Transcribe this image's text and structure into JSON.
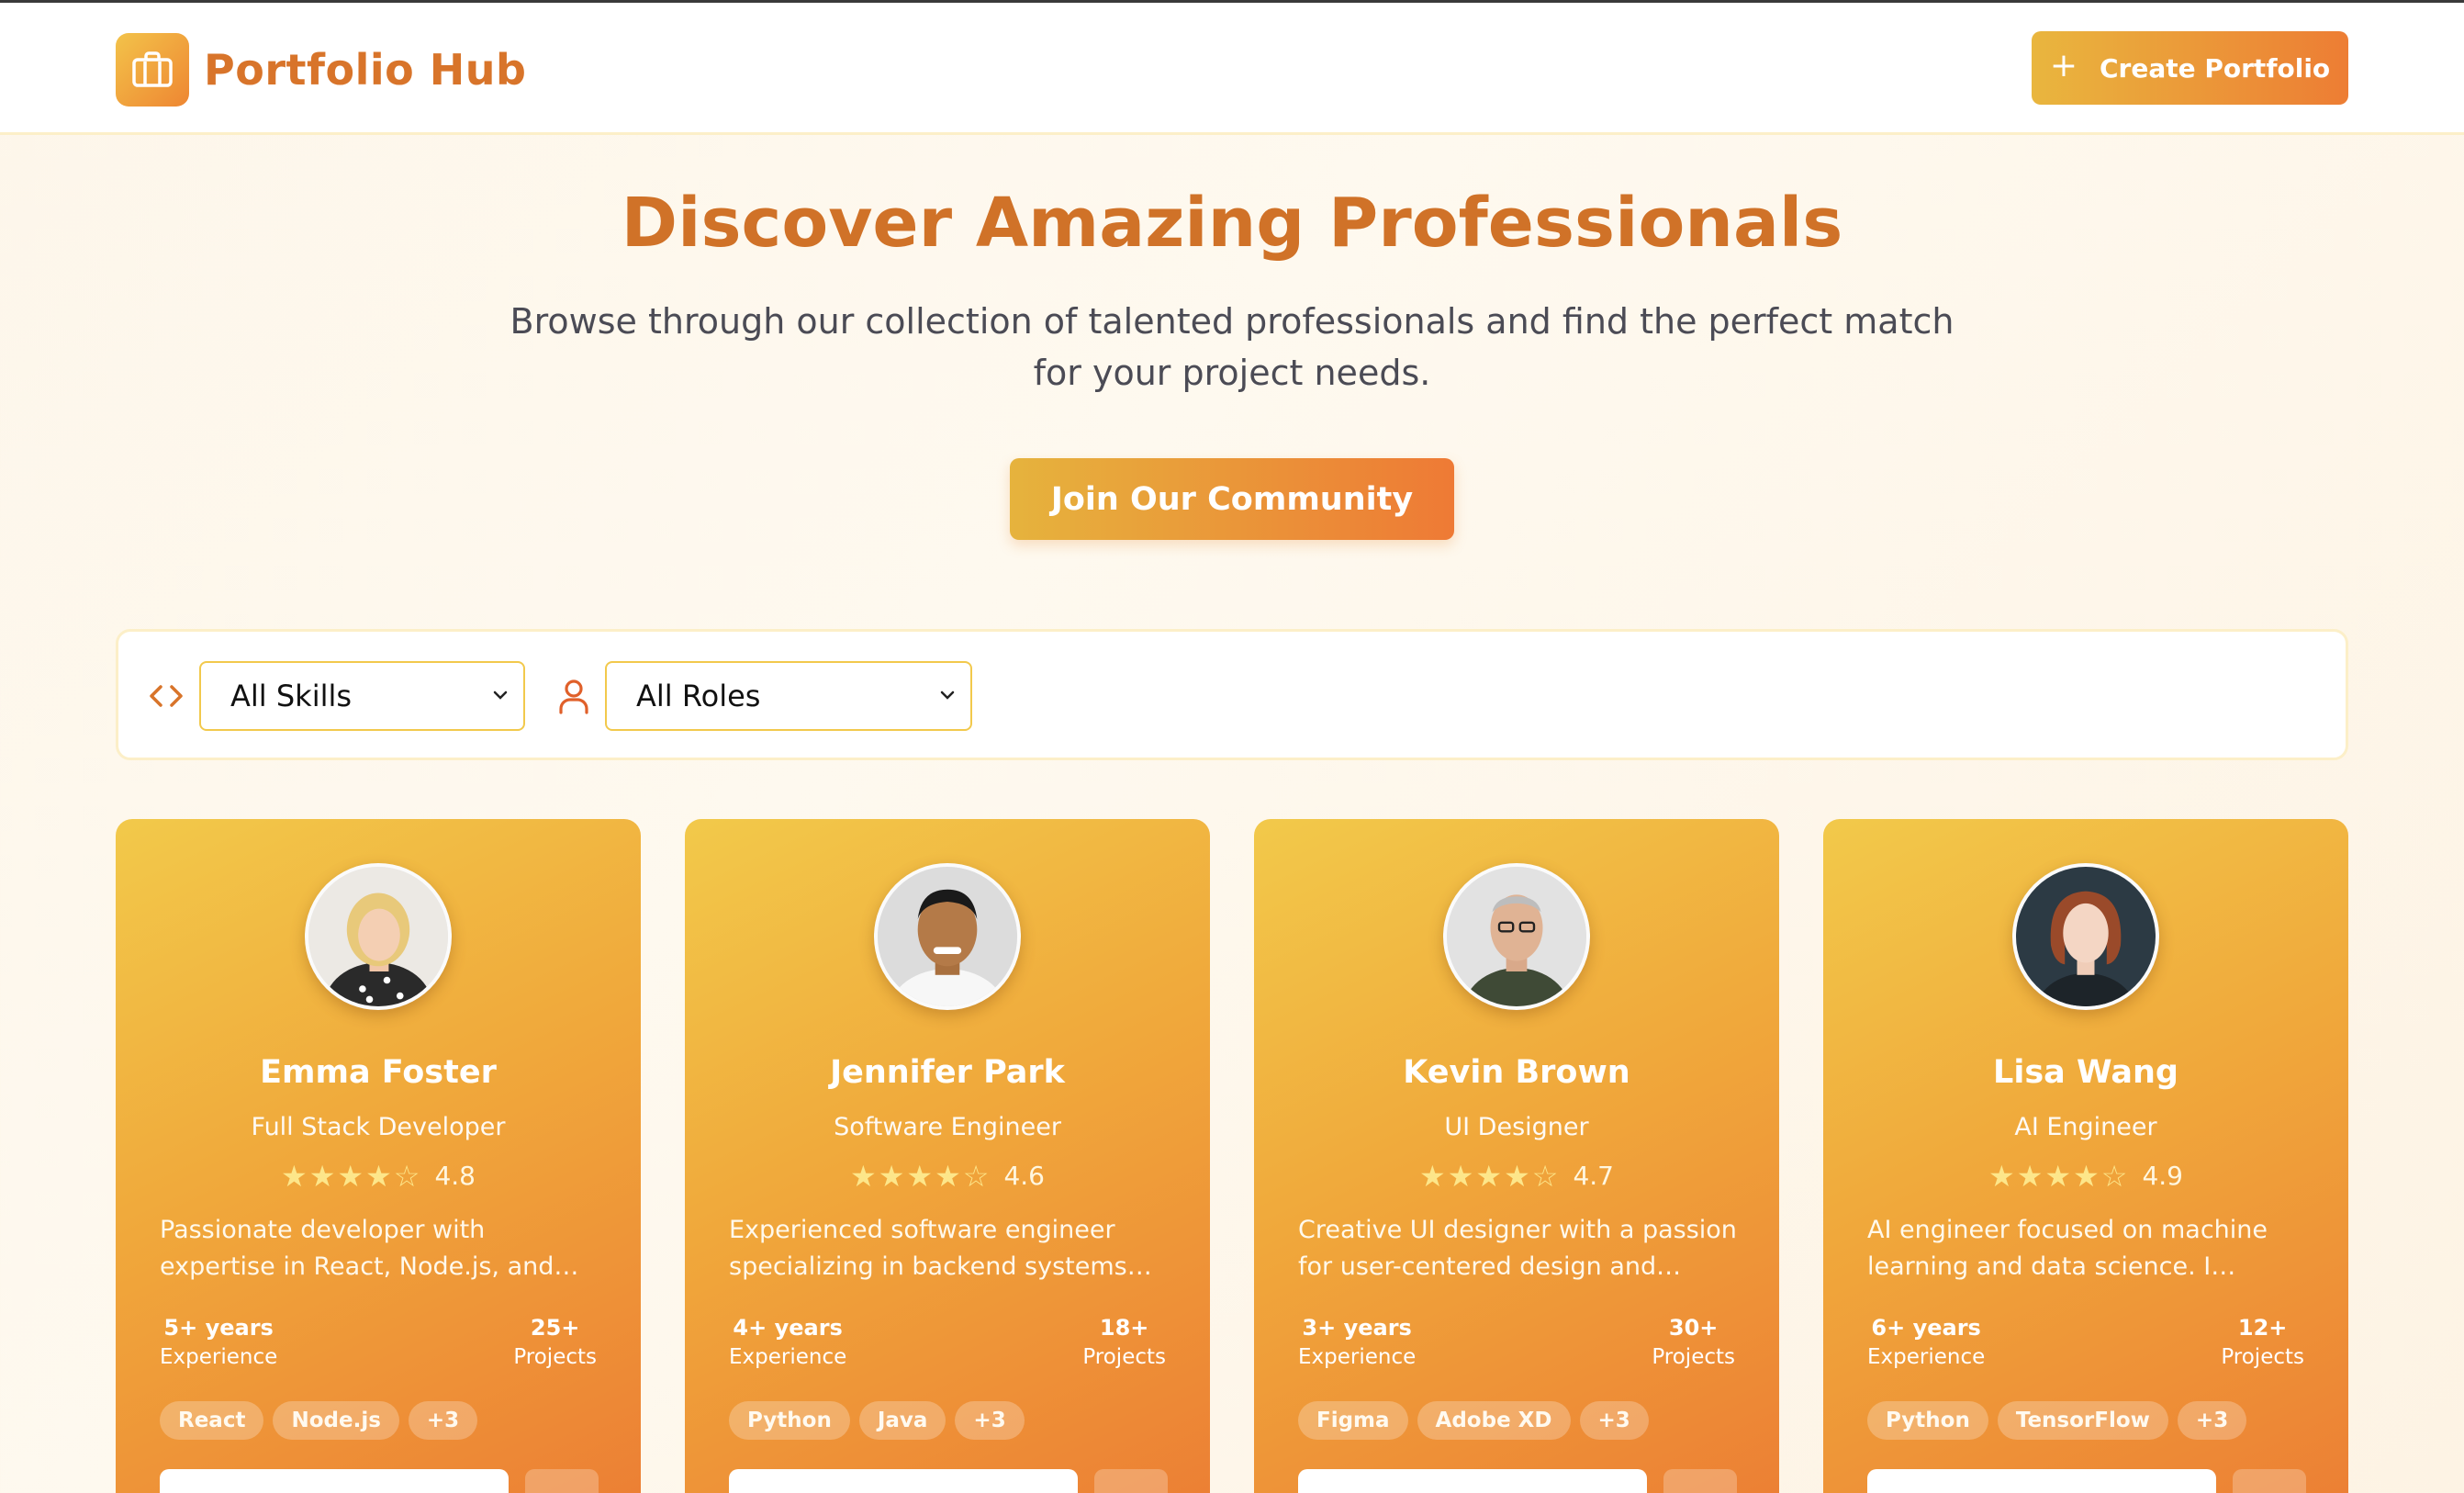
{
  "header": {
    "brand": "Portfolio Hub",
    "create_label": "Create Portfolio"
  },
  "hero": {
    "title": "Discover Amazing Professionals",
    "subtitle": "Browse through our collection of talented professionals and find the perfect match for your project needs.",
    "cta": "Join Our Community"
  },
  "filters": {
    "skills_value": "All Skills",
    "roles_value": "All Roles"
  },
  "cards": [
    {
      "name": "Emma Foster",
      "role": "Full Stack Developer",
      "rating": "4.8",
      "stars": 4,
      "description": "Passionate developer with expertise in React, Node.js, and cloud…",
      "experience_value": "5+ years",
      "experience_label": "Experience",
      "projects_value": "25+",
      "projects_label": "Projects",
      "tags": [
        "React",
        "Node.js",
        "+3"
      ]
    },
    {
      "name": "Jennifer Park",
      "role": "Software Engineer",
      "rating": "4.6",
      "stars": 4,
      "description": "Experienced software engineer specializing in backend systems an…",
      "experience_value": "4+ years",
      "experience_label": "Experience",
      "projects_value": "18+",
      "projects_label": "Projects",
      "tags": [
        "Python",
        "Java",
        "+3"
      ]
    },
    {
      "name": "Kevin Brown",
      "role": "UI Designer",
      "rating": "4.7",
      "stars": 4,
      "description": "Creative UI designer with a passion for user-centered design and…",
      "experience_value": "3+ years",
      "experience_label": "Experience",
      "projects_value": "30+",
      "projects_label": "Projects",
      "tags": [
        "Figma",
        "Adobe XD",
        "+3"
      ]
    },
    {
      "name": "Lisa Wang",
      "role": "AI Engineer",
      "rating": "4.9",
      "stars": 4,
      "description": "AI engineer focused on machine learning and data science. I develo…",
      "experience_value": "6+ years",
      "experience_label": "Experience",
      "projects_value": "12+",
      "projects_label": "Projects",
      "tags": [
        "Python",
        "TensorFlow",
        "+3"
      ]
    }
  ],
  "colors": {
    "brand_orange": "#d8742a",
    "gradient_start": "#f2c94a",
    "gradient_end": "#ec7e34",
    "star": "#fde68a"
  },
  "icons": {
    "logo": "briefcase-icon",
    "create": "plus-icon",
    "skills_filter": "code-icon",
    "roles_filter": "user-icon",
    "select": "chevron-down-icon",
    "rating": "star-icon"
  }
}
